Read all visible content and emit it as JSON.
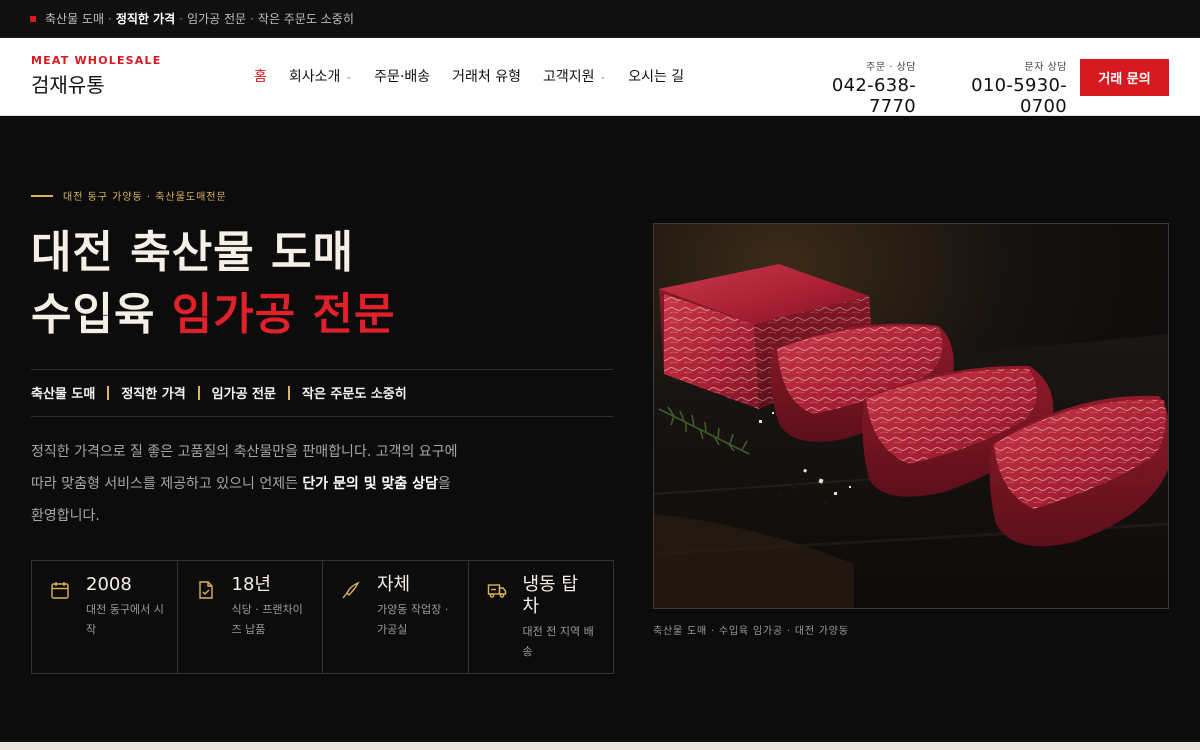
{
  "topbar": {
    "items": [
      "축산물 도매",
      "정직한 가격",
      "임가공 전문",
      "작은 주문도 소중히"
    ],
    "separator": "·"
  },
  "brand": {
    "tagline": "MEAT WHOLESALE",
    "name": "검재유통"
  },
  "nav": {
    "items": [
      {
        "label": "홈",
        "active": true,
        "dropdown": false
      },
      {
        "label": "회사소개",
        "active": false,
        "dropdown": true
      },
      {
        "label": "주문·배송",
        "active": false,
        "dropdown": false
      },
      {
        "label": "거래처 유형",
        "active": false,
        "dropdown": false
      },
      {
        "label": "고객지원",
        "active": false,
        "dropdown": true
      },
      {
        "label": "오시는 길",
        "active": false,
        "dropdown": false
      }
    ],
    "chevron": "⌄"
  },
  "contact": [
    {
      "label": "주문 · 상담",
      "number": "042-638-7770"
    },
    {
      "label": "문자 상담",
      "number": "010-5930-0700"
    }
  ],
  "cta": {
    "label": "거래 문의"
  },
  "hero": {
    "eyebrow": "대전 동구 가양동 · 축산물도매전문",
    "title_line1": "대전 축산물 도매",
    "title_line2_plain": "수입육 ",
    "title_line2_accent": "임가공 전문",
    "tags": [
      "축산물 도매",
      "정직한 가격",
      "임가공 전문",
      "작은 주문도 소중히"
    ],
    "desc_plain1": "정직한 가격으로 질 좋은 고품질의 축산물만을 판매합니다. 고객의 요구에 따라 맞춤형 서비스를 제공하고 있으니 언제든 ",
    "desc_bold": "단가 문의 및 맞춤 상담",
    "desc_plain2": "을 환영합니다."
  },
  "stats": [
    {
      "icon": "calendar-icon",
      "value": "2008",
      "sub": "대전 동구에서 시작"
    },
    {
      "icon": "document-check-icon",
      "value": "18년",
      "sub": "식당 · 프랜차이즈 납품"
    },
    {
      "icon": "knife-icon",
      "value": "자체",
      "sub": "가양동 작업장 · 가공실"
    },
    {
      "icon": "truck-icon",
      "value": "냉동 탑차",
      "sub": "대전 전 지역 배송"
    }
  ],
  "photo": {
    "caption": "축산물 도매 · 수입육 임가공 · 대전 가양동"
  },
  "colors": {
    "accent": "#d71920",
    "gold": "#d9b45a",
    "bg": "#0c0c0c"
  }
}
